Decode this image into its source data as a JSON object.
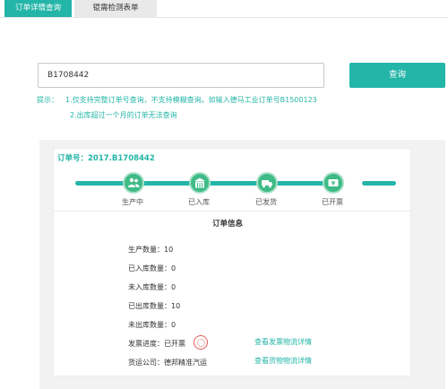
{
  "tabs": {
    "order_query": "订单详情查询",
    "inspection_form": "锟需检测表单"
  },
  "search": {
    "value": "B1708442",
    "button": "查询"
  },
  "hints": {
    "prefix": "提示：",
    "line1": "1.仅支持完整订单号查询，不支持模糊查询。如输入德马工业订单号B1500123",
    "line2": "2.出库超过一个月的订单无法查询"
  },
  "order": {
    "number_label": "订单号：2017.B1708442"
  },
  "steps": [
    {
      "label": "生产中",
      "icon": "people-icon",
      "completed": true
    },
    {
      "label": "已入库",
      "icon": "warehouse-icon",
      "completed": true
    },
    {
      "label": "已发货",
      "icon": "truck-icon",
      "completed": true
    },
    {
      "label": "已开票",
      "icon": "invoice-icon",
      "completed": true
    }
  ],
  "info": {
    "title": "订单信息",
    "produced": "生产数量：10",
    "in_stock": "已入库数量：0",
    "not_in_stock": "未入库数量：0",
    "shipped": "已出库数量：10",
    "not_shipped": "未出库数量：0",
    "invoice_status": "发票进度：已开票",
    "carrier": "货运公司：德邦精准汽运",
    "invoice_link": "查看发票物流详情",
    "cargo_link": "查看货物物流详情"
  },
  "colors": {
    "accent": "#23b5a7",
    "step_green": "#3ebb86",
    "panel_bg": "#f2f2f2"
  }
}
